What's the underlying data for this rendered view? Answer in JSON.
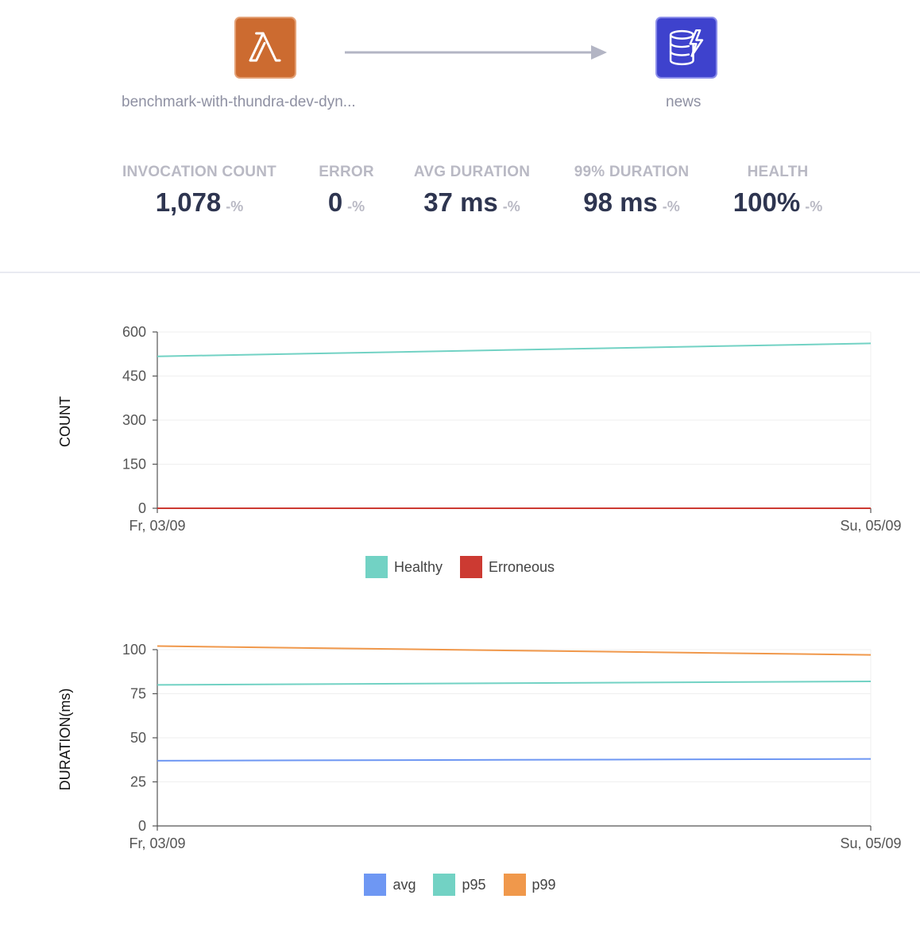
{
  "flow": {
    "source": {
      "name": "benchmark-with-thundra-dev-dyn...",
      "icon": "lambda-icon",
      "color": "#CC6B30"
    },
    "target": {
      "name": "news",
      "icon": "dynamodb-icon",
      "color": "#3E42CD"
    }
  },
  "metrics": [
    {
      "label": "INVOCATION COUNT",
      "value": "1,078",
      "change": "-%"
    },
    {
      "label": "ERROR",
      "value": "0",
      "change": "-%"
    },
    {
      "label": "AVG DURATION",
      "value": "37 ms",
      "change": "-%"
    },
    {
      "label": "99% DURATION",
      "value": "98 ms",
      "change": "-%"
    },
    {
      "label": "HEALTH",
      "value": "100%",
      "change": "-%"
    }
  ],
  "chart_data": [
    {
      "type": "line",
      "ylabel": "COUNT",
      "x": [
        "Fr, 03/09",
        "Su, 05/09"
      ],
      "ylim": [
        0,
        600
      ],
      "yticks": [
        0,
        150,
        300,
        450,
        600
      ],
      "grid": true,
      "legend": "bottom",
      "series": [
        {
          "name": "Healthy",
          "color": "#72D2C4",
          "values": [
            517,
            561
          ]
        },
        {
          "name": "Erroneous",
          "color": "#CC3A32",
          "values": [
            0,
            0
          ]
        }
      ]
    },
    {
      "type": "line",
      "ylabel": "DURATION(ms)",
      "x": [
        "Fr, 03/09",
        "Su, 05/09"
      ],
      "ylim": [
        0,
        100
      ],
      "yticks": [
        0,
        25,
        50,
        75,
        100
      ],
      "grid": true,
      "legend": "bottom",
      "series": [
        {
          "name": "avg",
          "color": "#6E97F3",
          "values": [
            37,
            38
          ]
        },
        {
          "name": "p95",
          "color": "#72D2C4",
          "values": [
            80,
            82
          ]
        },
        {
          "name": "p99",
          "color": "#F0984B",
          "values": [
            102,
            97
          ]
        }
      ]
    }
  ]
}
